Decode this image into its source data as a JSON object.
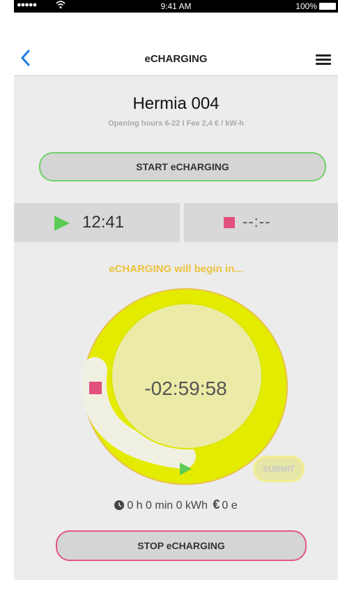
{
  "status_bar": {
    "signal": "●●●●●",
    "time": "9:41 AM",
    "battery": "100%"
  },
  "nav": {
    "title": "eCHARGING"
  },
  "station": {
    "name": "Hermia 004",
    "info": "Opening hours 6-22  I  Fee 2,4 € / kW-h"
  },
  "actions": {
    "start_label": "START eCHARGING",
    "stop_label": "STOP eCHARGING",
    "submit_label": "SUBMIT"
  },
  "times": {
    "start": "12:41",
    "stop": "--:--"
  },
  "countdown": {
    "message": "eCHARGING will begin in...",
    "value": "-02:59:58"
  },
  "stats": {
    "duration_energy": "0 h 0 min 0 kWh",
    "euro_symbol": "€",
    "cost": "0 e"
  },
  "colors": {
    "start_green": "#6fd06a",
    "stop_pink": "#e2577f",
    "dial_yellow": "#e3eb00",
    "dial_inner": "#ebeba7",
    "message_yellow": "#ecc33e"
  }
}
